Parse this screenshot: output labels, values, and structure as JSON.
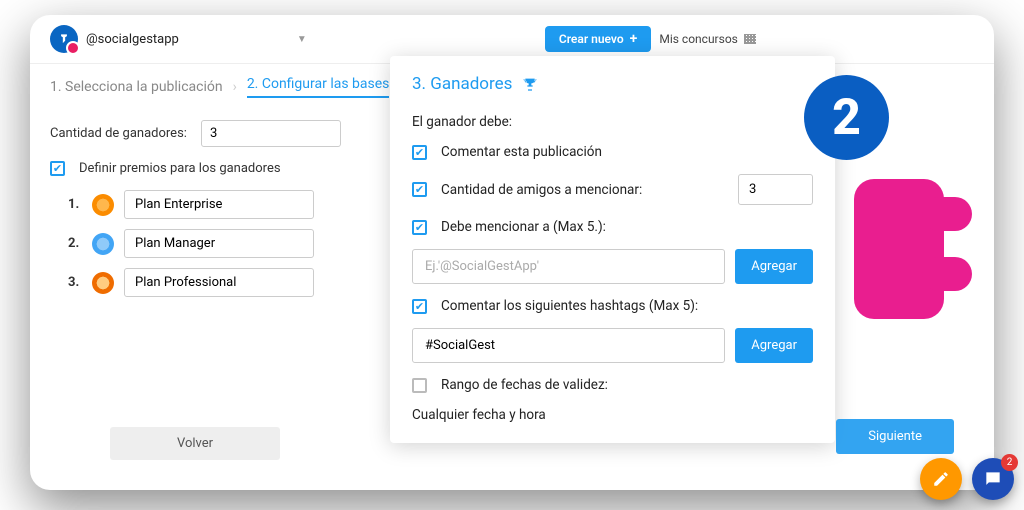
{
  "header": {
    "account": "@socialgestapp",
    "create_label": "Crear nuevo",
    "my_contests_label": "Mis concursos"
  },
  "steps": {
    "s1": "1. Selecciona la publicación",
    "s2": "2. Configurar las bases"
  },
  "left": {
    "qty_label": "Cantidad de ganadores:",
    "qty_value": "3",
    "define_prizes_label": "Definir premios para los ganadores",
    "prizes": [
      {
        "num": "1.",
        "name": "Plan Enterprise"
      },
      {
        "num": "2.",
        "name": "Plan Manager"
      },
      {
        "num": "3.",
        "name": "Plan Professional"
      }
    ],
    "back_label": "Volver"
  },
  "panel": {
    "title": "3. Ganadores",
    "must_label": "El ganador debe:",
    "opt_comment": "Comentar esta publicación",
    "opt_friends": "Cantidad de amigos a mencionar:",
    "opt_friends_value": "3",
    "opt_mention": "Debe mencionar a (Max 5.):",
    "mention_placeholder": "Ej.'@SocialGestApp'",
    "opt_hashtags": "Comentar los siguientes hashtags (Max 5):",
    "hashtag_value": "#SocialGest",
    "add_label": "Agregar",
    "opt_dates": "Rango de fechas de validez:",
    "any_date": "Cualquier fecha y hora"
  },
  "footer": {
    "next_label": "Siguiente"
  },
  "badge": {
    "number": "2",
    "chat_count": "2"
  }
}
